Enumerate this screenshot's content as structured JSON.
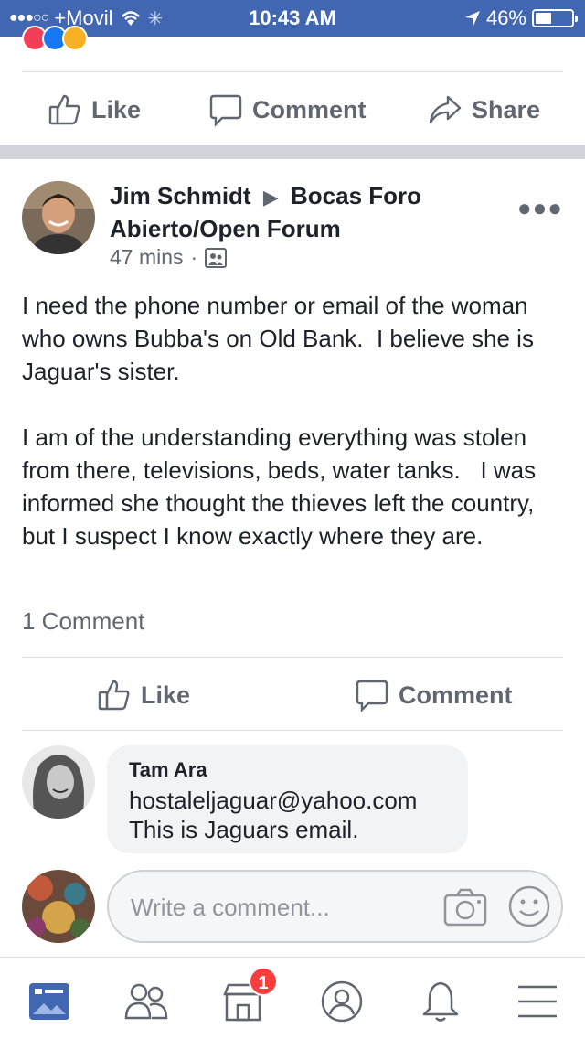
{
  "status_bar": {
    "carrier": "+Movil",
    "time": "10:43 AM",
    "battery": "46%",
    "battery_level": 0.46
  },
  "prev_post_actions": {
    "like": "Like",
    "comment": "Comment",
    "share": "Share"
  },
  "post": {
    "author": "Jim Schmidt",
    "group": "Bocas Foro Abierto/Open Forum",
    "time": "47 mins",
    "meta_separator": "·",
    "paragraphs": [
      "I need the phone number or email of the woman who owns Bubba's on Old Bank.  I believe she is Jaguar's sister.",
      "I am of the understanding everything was stolen from there, televisions, beds, water tanks.   I was informed she thought the thieves left the country, but I suspect I know exactly where they are."
    ],
    "comment_count": "1 Comment",
    "actions": {
      "like": "Like",
      "comment": "Comment"
    }
  },
  "comment": {
    "author": "Tam Ara",
    "line1": "hostaleljaguar@yahoo.com",
    "line2": "This is Jaguars email."
  },
  "composer": {
    "placeholder": "Write a comment..."
  },
  "tabbar": {
    "marketplace_badge": "1"
  },
  "colors": {
    "brand_blue": "#4267b2",
    "badge_red": "#fa3e3e",
    "icon_gray": "#606770"
  }
}
